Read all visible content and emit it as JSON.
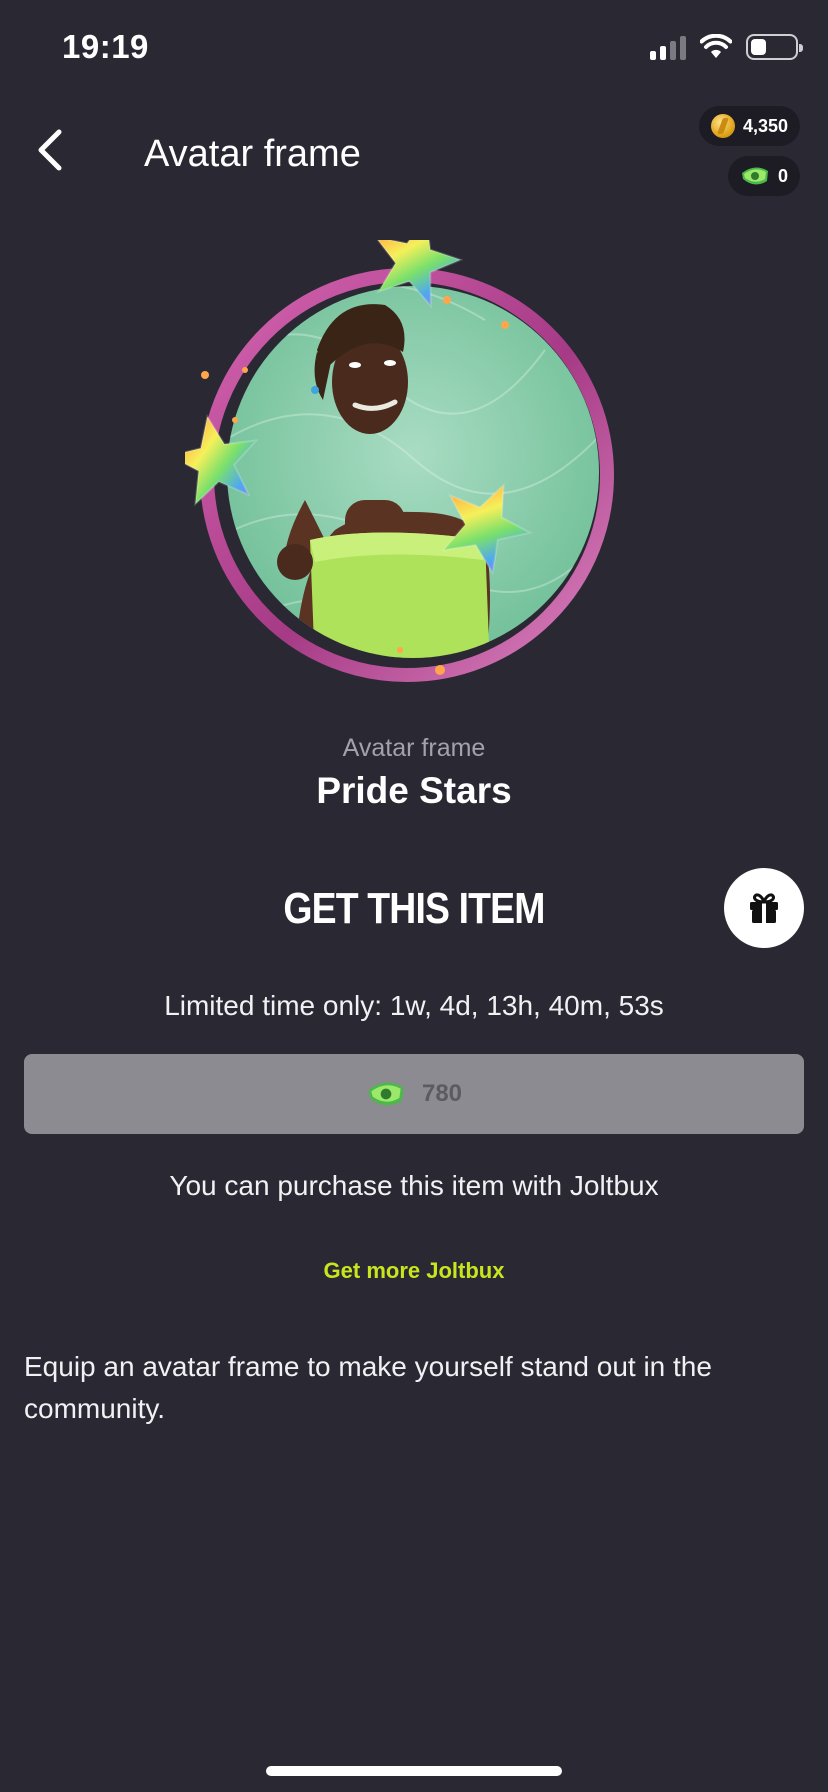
{
  "status_bar": {
    "time": "19:19",
    "battery_level": 0.35
  },
  "header": {
    "title": "Avatar frame",
    "back_icon": "chevron-left-icon"
  },
  "balances": {
    "coins": {
      "value": "4,350",
      "icon": "coin-icon"
    },
    "joltbux": {
      "value": "0",
      "icon": "joltbux-icon"
    }
  },
  "item": {
    "type": "Avatar frame",
    "name": "Pride Stars"
  },
  "purchase": {
    "title": "GET THIS ITEM",
    "limited_time": "Limited time only: 1w, 4d, 13h, 40m, 53s",
    "price": "780",
    "price_icon": "joltbux-icon",
    "note": "You can purchase this item with Joltbux",
    "get_more_link": "Get more Joltbux",
    "gift_icon": "gift-icon"
  },
  "description": "Equip an avatar frame to make yourself stand out in the community.",
  "colors": {
    "background": "#2a2933",
    "accent_link": "#c9e51d",
    "price_button": "#8c8b91",
    "frame_ring": "#d85cb4"
  }
}
